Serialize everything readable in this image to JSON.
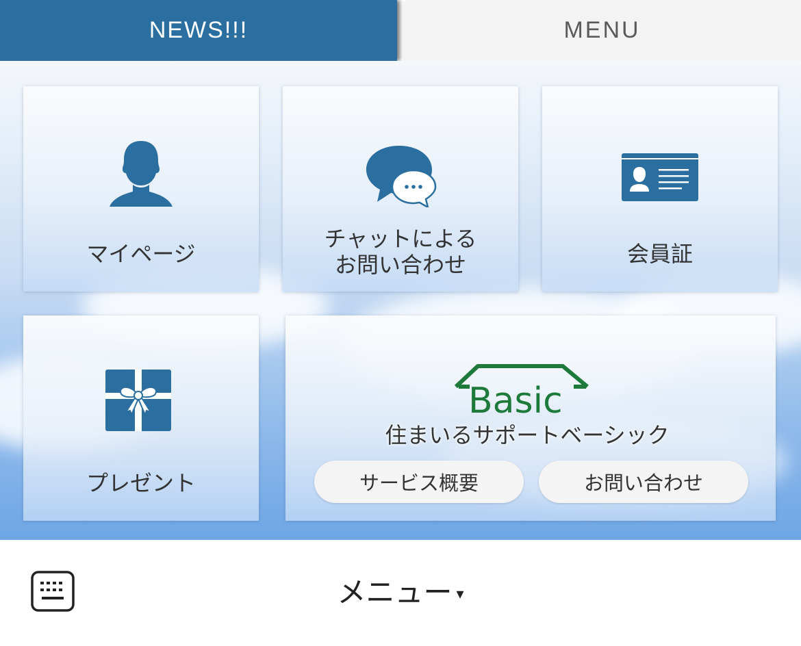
{
  "tabs": {
    "news": "NEWS!!!",
    "menu": "MENU"
  },
  "tiles": {
    "mypage": "マイページ",
    "chat": {
      "line1": "チャットによる",
      "line2": "お問い合わせ"
    },
    "member_card": "会員証",
    "present": "プレゼント"
  },
  "basic": {
    "logo_text": "Basic",
    "caption": "住まいるサポートベーシック",
    "service_button": "サービス概要",
    "contact_button": "お問い合わせ"
  },
  "bottom_bar": {
    "title": "メニュー",
    "arrow": "▾"
  },
  "colors": {
    "brand_blue": "#2a6f9f",
    "logo_green": "#1e7a3a"
  },
  "icons": [
    "person-icon",
    "chat-bubbles-icon",
    "id-card-icon",
    "gift-icon",
    "keyboard-icon"
  ]
}
